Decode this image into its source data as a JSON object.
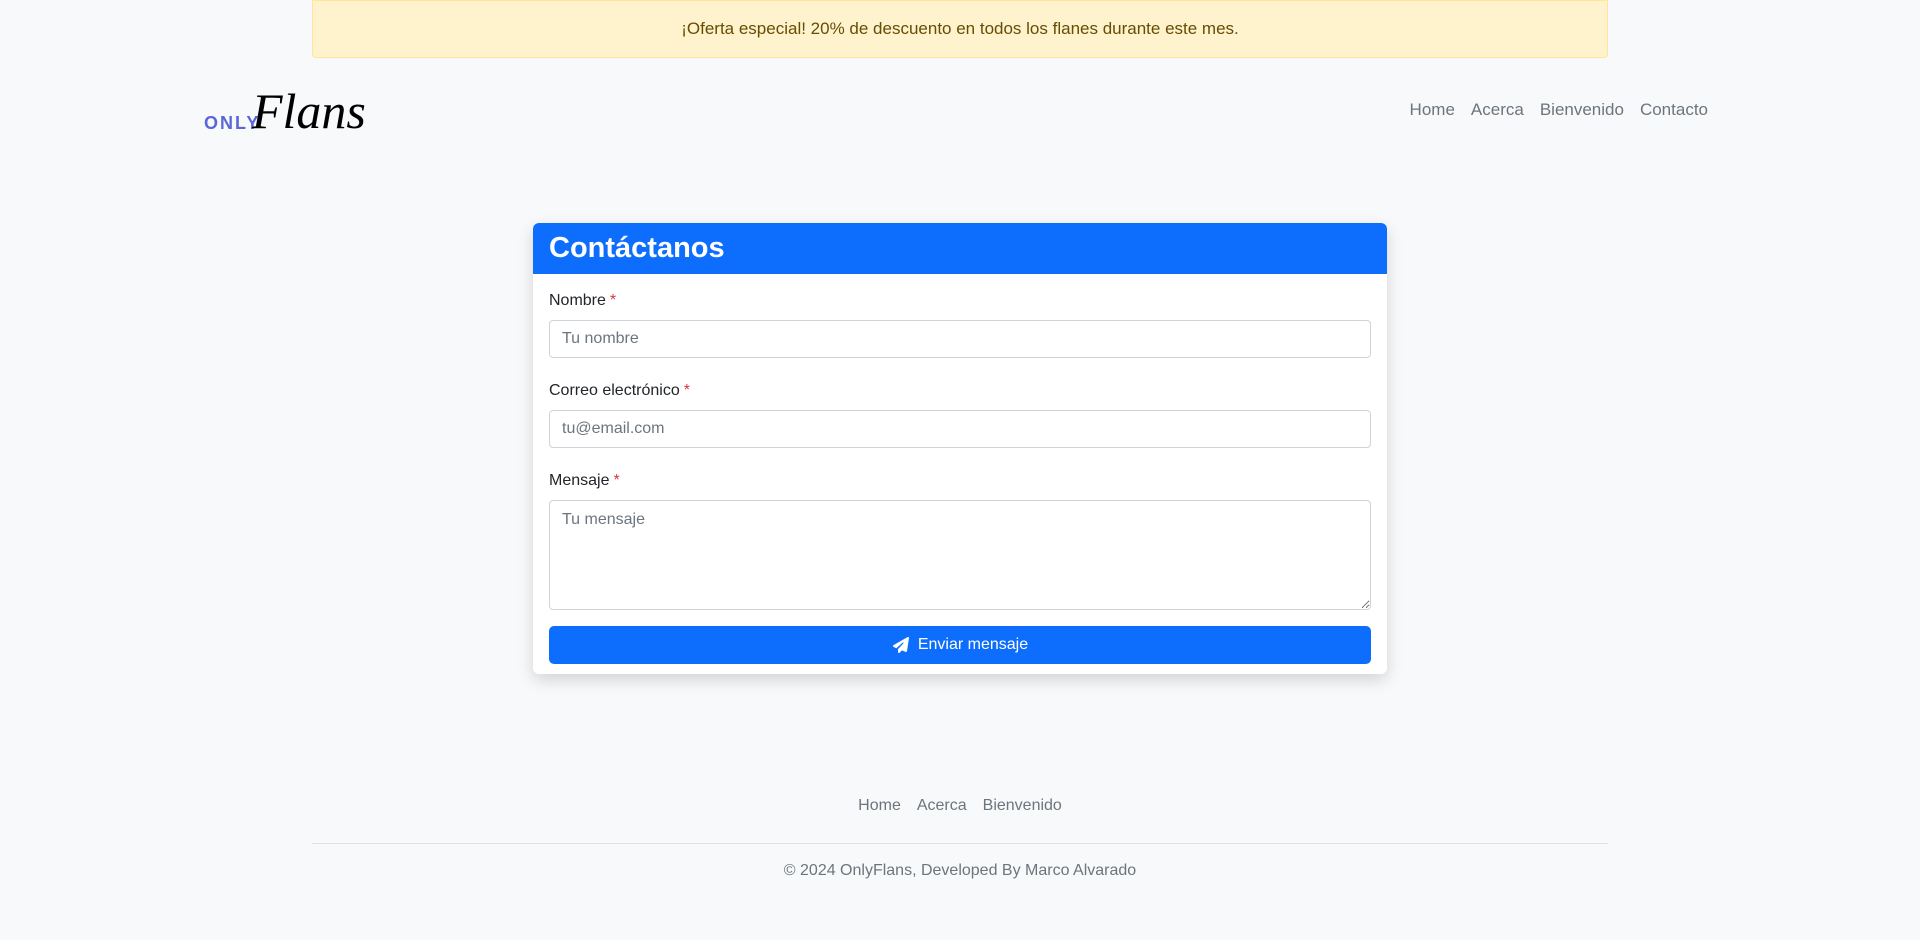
{
  "promo": {
    "text": "¡Oferta especial! 20% de descuento en todos los flanes durante este mes."
  },
  "header": {
    "logo": {
      "prefix": "ONLY",
      "script": "Flans",
      "prefix_color": "#5a67d8",
      "script_color": "#000000"
    },
    "nav": [
      "Home",
      "Acerca",
      "Bienvenido",
      "Contacto"
    ]
  },
  "contact_form": {
    "title": "Contáctanos",
    "name": {
      "label": "Nombre",
      "required_mark": "*",
      "placeholder": "Tu nombre",
      "value": ""
    },
    "email": {
      "label": "Correo electrónico",
      "required_mark": "*",
      "placeholder": "tu@email.com",
      "value": ""
    },
    "message": {
      "label": "Mensaje",
      "required_mark": "*",
      "placeholder": "Tu mensaje",
      "value": ""
    },
    "submit": {
      "label": "Enviar mensaje",
      "icon": "paper-plane-icon"
    }
  },
  "footer": {
    "nav": [
      "Home",
      "Acerca",
      "Bienvenido"
    ],
    "copyright": "© 2024 OnlyFlans, Developed By Marco Alvarado"
  },
  "colors": {
    "primary": "#0d6efd",
    "required": "#dc3545",
    "promo_bg": "#fff3cd",
    "promo_text": "#664d03",
    "muted": "#6c757d",
    "page_bg": "#f8f9fa"
  }
}
